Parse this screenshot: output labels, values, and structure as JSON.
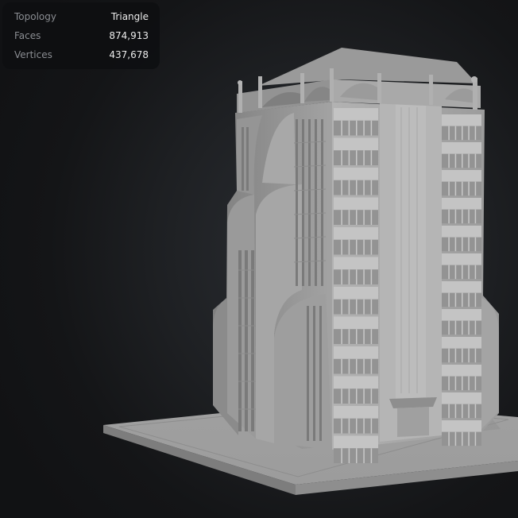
{
  "stats": [
    {
      "label": "Topology",
      "value": "Triangle"
    },
    {
      "label": "Faces",
      "value": "874,913"
    },
    {
      "label": "Vertices",
      "value": "437,678"
    }
  ],
  "model": {
    "subject": "building-model",
    "material_color": "#a9a9a9"
  }
}
